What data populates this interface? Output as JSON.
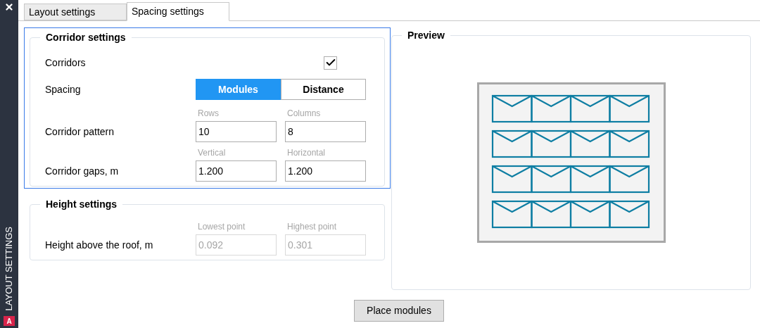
{
  "sidebar": {
    "title": "LAYOUT SETTINGS",
    "logo": "A"
  },
  "tabs": [
    {
      "label": "Layout settings",
      "selected": false
    },
    {
      "label": "Spacing settings",
      "selected": true
    }
  ],
  "groups": [
    {
      "title": "Corridor settings",
      "focused": true,
      "rows": [
        {
          "kind": "checkbox",
          "label": "Corridors",
          "checked": true
        },
        {
          "kind": "toggle",
          "label": "Spacing",
          "options": [
            {
              "label": "Modules",
              "selected": true
            },
            {
              "label": "Distance",
              "selected": false
            }
          ]
        },
        {
          "kind": "inputs",
          "label": "Corridor pattern",
          "fields": [
            {
              "caption": "Rows",
              "value": "10",
              "disabled": false
            },
            {
              "caption": "Columns",
              "value": "8",
              "disabled": false
            }
          ]
        },
        {
          "kind": "inputs",
          "label": "Corridor gaps, m",
          "fields": [
            {
              "caption": "Vertical",
              "value": "1.200",
              "disabled": false
            },
            {
              "caption": "Horizontal",
              "value": "1.200",
              "disabled": false
            }
          ]
        }
      ]
    },
    {
      "title": "Height settings",
      "focused": false,
      "rows": [
        {
          "kind": "inputs",
          "label": "Height above the roof, m",
          "fields": [
            {
              "caption": "Lowest point",
              "value": "0.092",
              "disabled": true
            },
            {
              "caption": "Highest point",
              "value": "0.301",
              "disabled": true
            }
          ]
        }
      ]
    }
  ],
  "preview": {
    "title": "Preview"
  },
  "action": "Place modules"
}
